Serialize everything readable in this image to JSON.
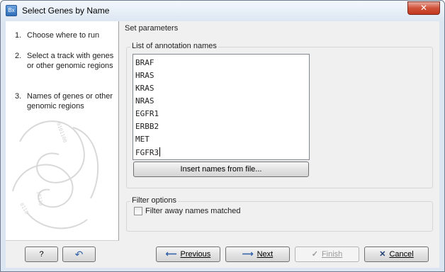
{
  "window": {
    "title": "Select Genes by Name",
    "icon_text": "Bx",
    "close_symbol": "✕"
  },
  "steps": [
    {
      "num": "1.",
      "text": "Choose where to run"
    },
    {
      "num": "2.",
      "text": "Select a track with genes or other genomic regions"
    },
    {
      "num": "3.",
      "text": "Names of genes or other genomic regions"
    }
  ],
  "params": {
    "section_title": "Set parameters",
    "annotation_group_title": "List of annotation names",
    "names": [
      "BRAF",
      "HRAS",
      "KRAS",
      "NRAS",
      "EGFR1",
      "ERBB2",
      "MET",
      "FGFR3"
    ],
    "insert_button": "Insert names from file...",
    "filter_group_title": "Filter options",
    "filter_checkbox_label": "Filter away names matched",
    "filter_checked": false
  },
  "footer": {
    "help_label": "?",
    "reset_icon": "↶",
    "previous_label": "Previous",
    "next_label": "Next",
    "finish_label": "Finish",
    "cancel_label": "Cancel"
  }
}
